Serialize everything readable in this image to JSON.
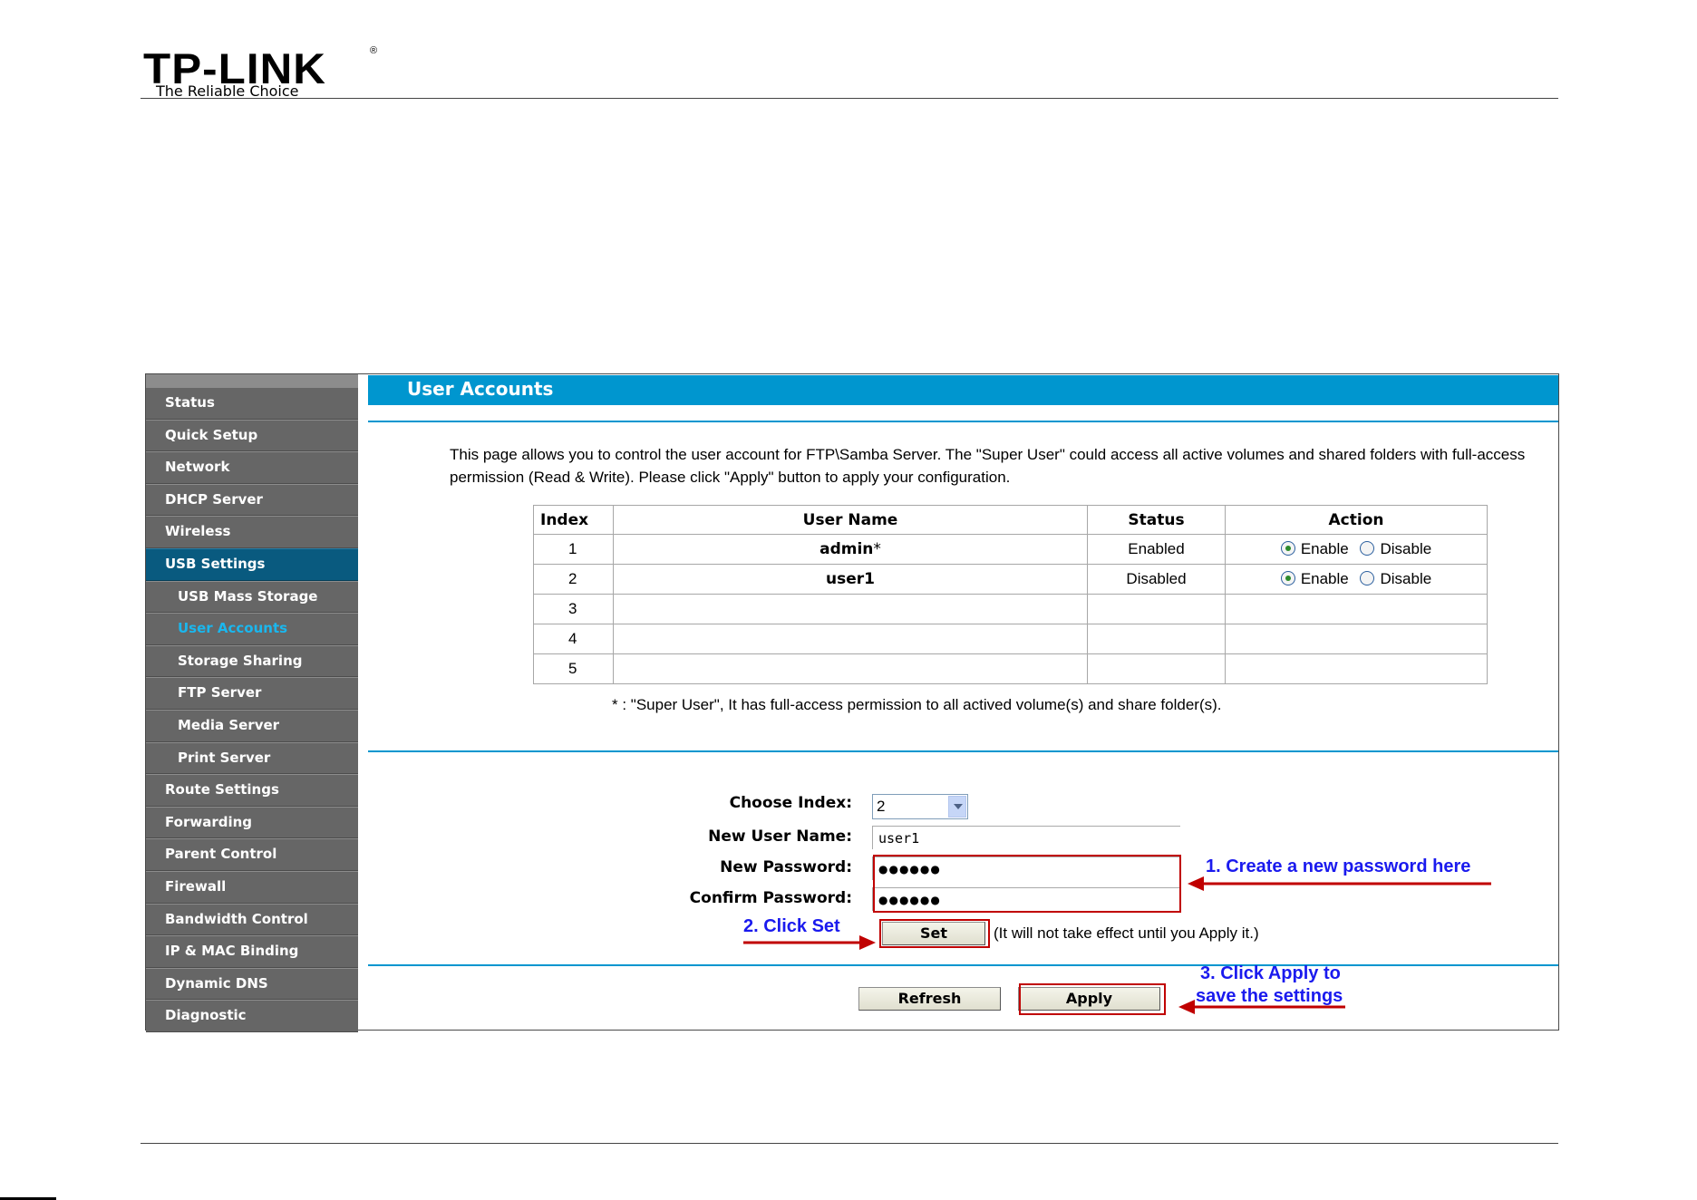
{
  "brand": {
    "logo": "TP-LINK",
    "registered": "®",
    "tagline": "The Reliable Choice"
  },
  "sidebar": {
    "items": [
      {
        "label": "Status",
        "sub": false,
        "state": ""
      },
      {
        "label": "Quick Setup",
        "sub": false,
        "state": ""
      },
      {
        "label": "Network",
        "sub": false,
        "state": ""
      },
      {
        "label": "DHCP Server",
        "sub": false,
        "state": ""
      },
      {
        "label": "Wireless",
        "sub": false,
        "state": ""
      },
      {
        "label": "USB Settings",
        "sub": false,
        "state": "active-parent"
      },
      {
        "label": "USB Mass Storage",
        "sub": true,
        "state": ""
      },
      {
        "label": "User Accounts",
        "sub": true,
        "state": "active"
      },
      {
        "label": "Storage Sharing",
        "sub": true,
        "state": ""
      },
      {
        "label": "FTP Server",
        "sub": true,
        "state": ""
      },
      {
        "label": "Media Server",
        "sub": true,
        "state": ""
      },
      {
        "label": "Print Server",
        "sub": true,
        "state": ""
      },
      {
        "label": "Route Settings",
        "sub": false,
        "state": ""
      },
      {
        "label": "Forwarding",
        "sub": false,
        "state": ""
      },
      {
        "label": "Parent Control",
        "sub": false,
        "state": ""
      },
      {
        "label": "Firewall",
        "sub": false,
        "state": ""
      },
      {
        "label": "Bandwidth Control",
        "sub": false,
        "state": ""
      },
      {
        "label": "IP & MAC Binding",
        "sub": false,
        "state": ""
      },
      {
        "label": "Dynamic DNS",
        "sub": false,
        "state": ""
      },
      {
        "label": "Diagnostic",
        "sub": false,
        "state": ""
      }
    ]
  },
  "main": {
    "title": "User Accounts",
    "description": "This page allows you to control the user account for FTP\\Samba Server. The \"Super User\" could access all active volumes and shared folders with full-access permission (Read & Write). Please click \"Apply\" button to apply your configuration.",
    "table": {
      "headers": {
        "index": "Index",
        "user_name": "User Name",
        "status": "Status",
        "action": "Action"
      },
      "rows": [
        {
          "index": "1",
          "user_name": "admin",
          "super_mark": "*",
          "status": "Enabled",
          "enable": "Enable",
          "disable": "Disable",
          "selected": "enable"
        },
        {
          "index": "2",
          "user_name": "user1",
          "super_mark": "",
          "status": "Disabled",
          "enable": "Enable",
          "disable": "Disable",
          "selected": "enable"
        },
        {
          "index": "3",
          "user_name": "",
          "status": ""
        },
        {
          "index": "4",
          "user_name": "",
          "status": ""
        },
        {
          "index": "5",
          "user_name": "",
          "status": ""
        }
      ]
    },
    "note": "* : \"Super User\", It has full-access permission to all actived volume(s) and share folder(s).",
    "form": {
      "choose_index_label": "Choose Index:",
      "choose_index_value": "2",
      "new_user_name_label": "New User Name:",
      "new_user_name_value": "user1",
      "new_password_label": "New Password:",
      "new_password_value": "●●●●●●",
      "confirm_password_label": "Confirm Password:",
      "confirm_password_value": "●●●●●●",
      "set_label": "Set",
      "set_note": "(It will not take effect until you Apply it.)",
      "refresh_label": "Refresh",
      "apply_label": "Apply"
    }
  },
  "annotations": {
    "step1": "1. Create a new password here",
    "step2": "2. Click Set",
    "step3_line1": "3. Click Apply to",
    "step3_line2": "save the settings"
  },
  "colors": {
    "accent": "#0096cf",
    "sidebar": "#666666",
    "active_parent": "#095a7f",
    "active_text": "#1ab7ee",
    "annotation": "#1a1aee",
    "highlight": "#c00000"
  }
}
